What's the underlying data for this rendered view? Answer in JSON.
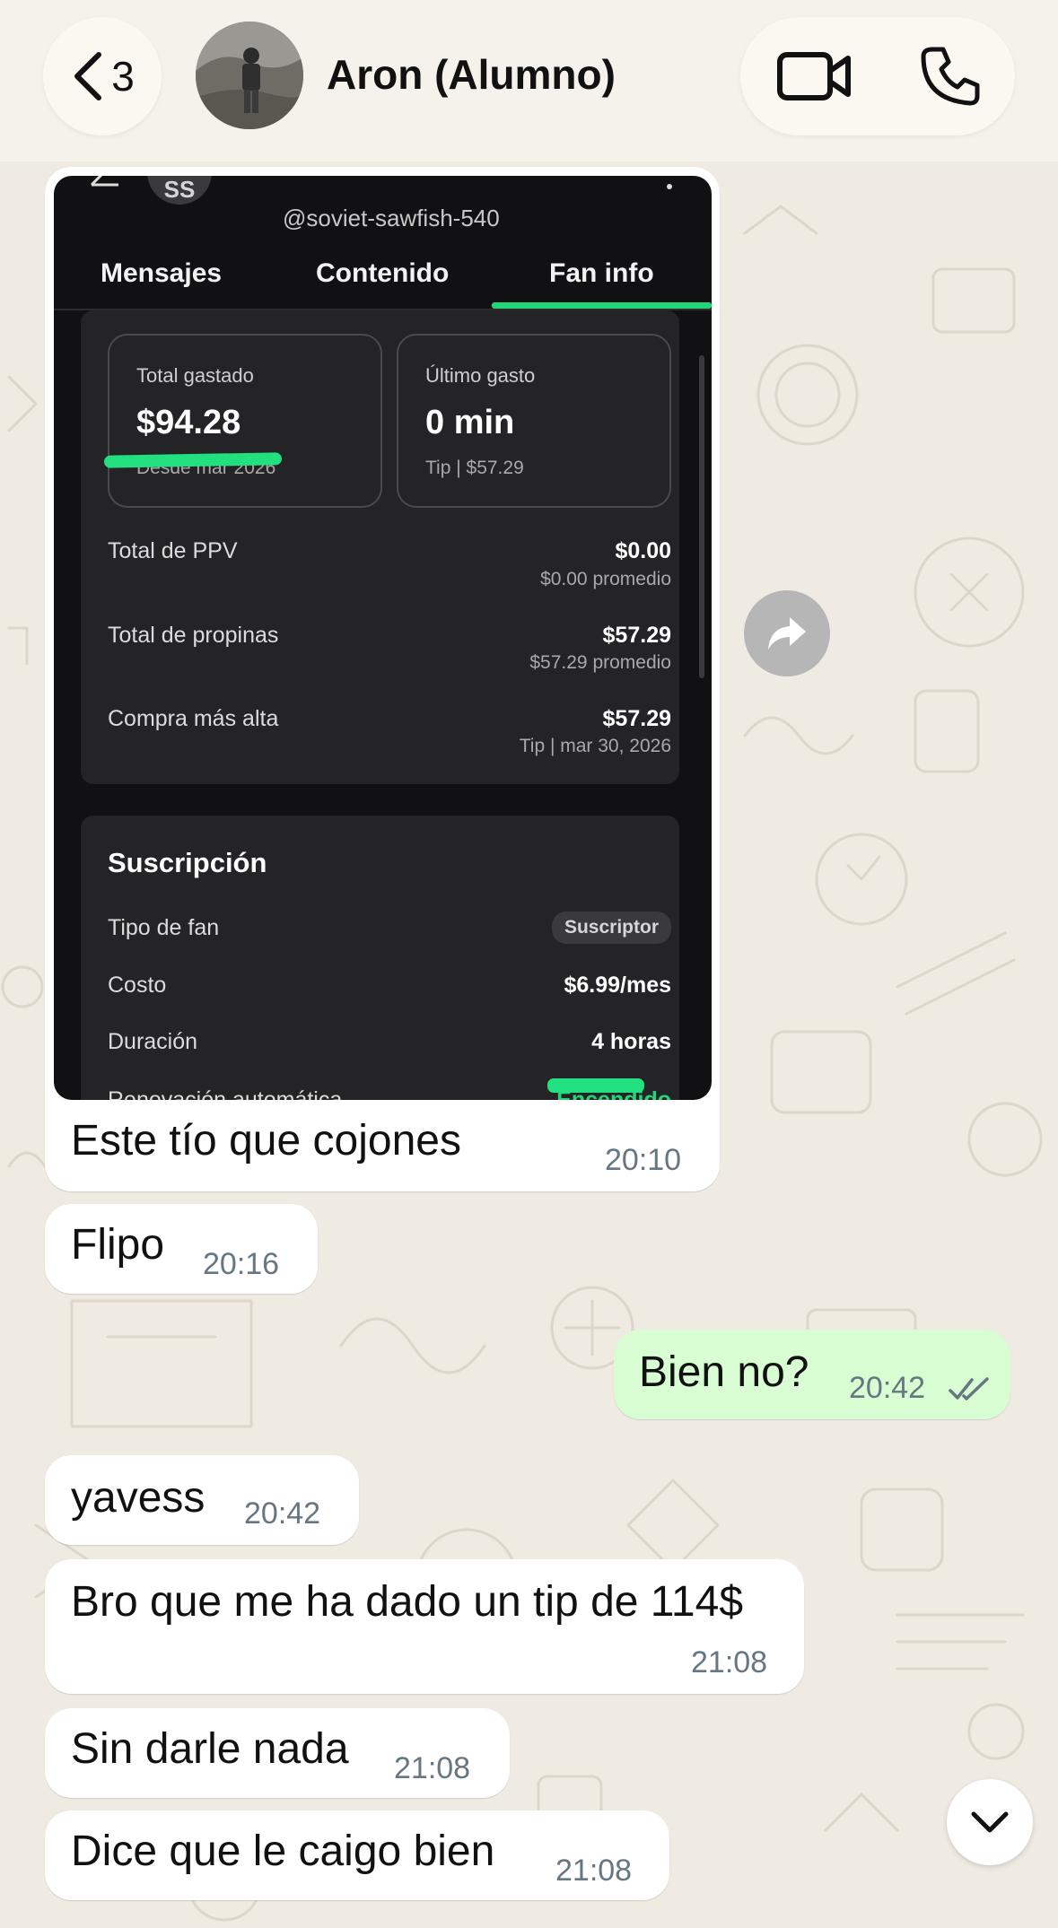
{
  "header": {
    "unread_count": "3",
    "contact_name": "Aron (Alumno)"
  },
  "screenshot": {
    "avatar_initials": "SS",
    "handle": "@soviet-sawfish-540",
    "tabs": [
      "Mensajes",
      "Contenido",
      "Fan info"
    ],
    "active_tab": "Fan info",
    "total_spent": {
      "label": "Total gastado",
      "value": "$94.28",
      "since": "Desde mar 2026"
    },
    "last_spend": {
      "label": "Último gasto",
      "value": "0 min",
      "detail": "Tip | $57.29"
    },
    "rows": [
      {
        "label": "Total de PPV",
        "value": "$0.00",
        "sub": "$0.00 promedio"
      },
      {
        "label": "Total de propinas",
        "value": "$57.29",
        "sub": "$57.29 promedio"
      },
      {
        "label": "Compra más alta",
        "value": "$57.29",
        "sub": "Tip | mar 30, 2026"
      }
    ],
    "subscription": {
      "title": "Suscripción",
      "fan_type_label": "Tipo de fan",
      "fan_type_value": "Suscriptor",
      "cost_label": "Costo",
      "cost_value": "$6.99/mes",
      "duration_label": "Duración",
      "duration_value": "4 horas",
      "renewal_label": "Renovación automática",
      "renewal_value": "Encendido"
    },
    "highlight_color": "#22e07f"
  },
  "messages": [
    {
      "direction": "in",
      "text": "Este tío que cojones",
      "time": "20:10"
    },
    {
      "direction": "in",
      "text": "Flipo",
      "time": "20:16"
    },
    {
      "direction": "out",
      "text": "Bien no?",
      "time": "20:42",
      "status": "read"
    },
    {
      "direction": "in",
      "text": "yavess",
      "time": "20:42"
    },
    {
      "direction": "in",
      "text": "Bro que me ha dado un tip de 114$",
      "time": "21:08"
    },
    {
      "direction": "in",
      "text": "Sin darle nada",
      "time": "21:08"
    },
    {
      "direction": "in",
      "text": "Dice que le caigo bien",
      "time": "21:08"
    }
  ],
  "colors": {
    "chat_bg": "#efeae2",
    "incoming_bubble": "#ffffff",
    "outgoing_bubble": "#d9fdd3",
    "read_ticks": "#667781"
  },
  "icons": [
    "chevron-left-icon",
    "video-call-icon",
    "phone-icon",
    "forward-icon",
    "chevron-down-icon",
    "double-check-icon"
  ]
}
